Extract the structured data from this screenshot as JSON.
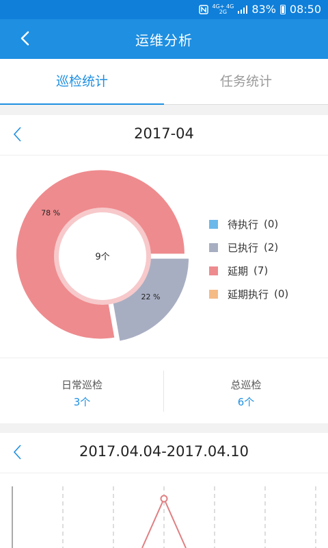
{
  "status_bar": {
    "network_top": "4G+ 4G",
    "network_bottom": "2G",
    "battery_text": "83%",
    "time": "08:50"
  },
  "header": {
    "title": "运维分析"
  },
  "tabs": [
    {
      "label": "巡检统计",
      "active": true
    },
    {
      "label": "任务统计",
      "active": false
    }
  ],
  "month_card": {
    "period": "2017-04",
    "center_label": "9个",
    "chart_data": {
      "type": "pie",
      "categories": [
        "待执行",
        "已执行",
        "延期",
        "延期执行"
      ],
      "values": [
        0,
        2,
        7,
        0
      ],
      "slice_labels": [
        "78 %",
        "22 %"
      ],
      "colors": [
        "#6bb8ea",
        "#a8aec2",
        "#ee8b8e",
        "#f5bb85"
      ]
    },
    "legend": [
      {
        "label": "待执行",
        "count": "(0)",
        "color": "#6bb8ea"
      },
      {
        "label": "已执行",
        "count": "(2)",
        "color": "#a8aec2"
      },
      {
        "label": "延期",
        "count": "(7)",
        "color": "#ee8b8e"
      },
      {
        "label": "延期执行",
        "count": "(0)",
        "color": "#f5bb85"
      }
    ],
    "stats": {
      "daily_label": "日常巡检",
      "daily_value": "3个",
      "total_label": "总巡检",
      "total_value": "6个"
    }
  },
  "week_card": {
    "period": "2017.04.04-2017.04.10"
  },
  "colors": {
    "primary": "#1e8fe1",
    "status_bar": "#0f7fd9",
    "delayed": "#ee8b8e",
    "executed": "#a8aec2"
  },
  "icons": [
    "nfc-icon",
    "signal-icon",
    "battery-icon",
    "back-arrow-icon",
    "chevron-left-icon"
  ]
}
